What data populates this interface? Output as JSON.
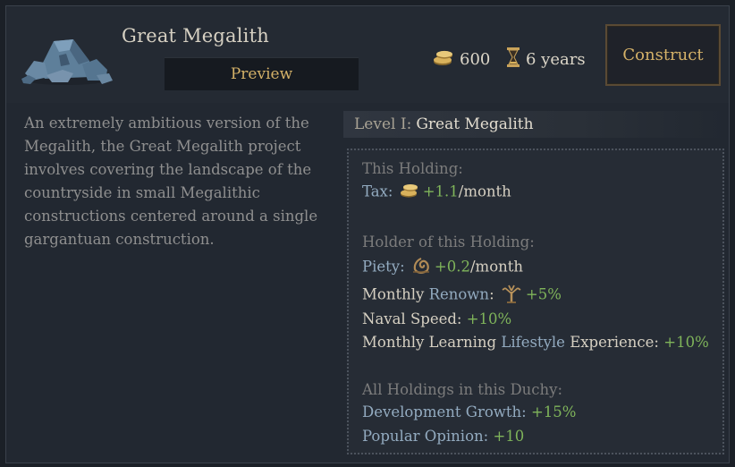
{
  "building": {
    "title": "Great Megalith",
    "preview_label": "Preview",
    "icon": "megalith-stones-icon"
  },
  "cost": {
    "gold": "600",
    "gold_icon": "gold-coins-icon",
    "time": "6 years",
    "time_icon": "hourglass-icon"
  },
  "construct_label": "Construct",
  "description": "An extremely ambitious version of the Megalith, the Great Megalith project involves covering the landscape of the countryside in small Megalithic constructions centered around a single gargantuan construction.",
  "level": {
    "prefix": "Level I:",
    "name": "Great Megalith"
  },
  "effects": {
    "this_holding": {
      "heading": "This Holding:",
      "tax_label": "Tax:",
      "tax_value": "+1.1",
      "tax_unit": "/month"
    },
    "holder": {
      "heading": "Holder of this Holding:",
      "piety_label": "Piety:",
      "piety_value": "+0.2",
      "piety_unit": "/month",
      "renown_prefix": "Monthly",
      "renown_link": "Renown",
      "renown_colon": ":",
      "renown_value": "+5%",
      "naval_label": "Naval Speed:",
      "naval_value": "+10%",
      "learning_prefix": "Monthly Learning",
      "learning_link": "Lifestyle",
      "learning_suffix": "Experience:",
      "learning_value": "+10%"
    },
    "duchy": {
      "heading": "All Holdings in this Duchy:",
      "dev_label": "Development Growth:",
      "dev_value": "+15%",
      "opinion_label": "Popular Opinion:",
      "opinion_value": "+10"
    }
  },
  "colors": {
    "accent_gold": "#d4b168",
    "positive": "#7fb45a",
    "link_blue": "#93abc0",
    "heading_gray": "#7c7c7c"
  }
}
